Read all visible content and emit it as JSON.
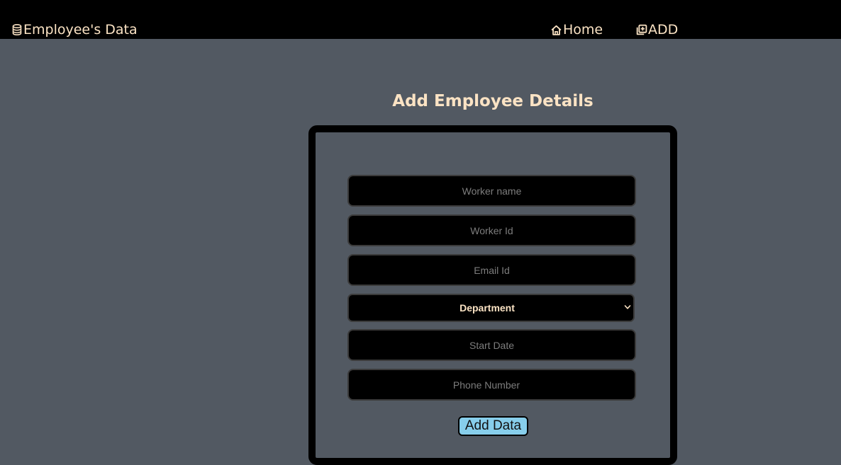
{
  "navbar": {
    "brand_icon": "database-icon",
    "brand_label": "Employee's Data",
    "links": [
      {
        "icon": "house-icon",
        "label": "Home"
      },
      {
        "icon": "add-copy-icon",
        "label": "ADD"
      }
    ]
  },
  "form": {
    "title": "Add Employee Details",
    "fields": {
      "worker_name": {
        "placeholder": "Worker name",
        "value": ""
      },
      "worker_id": {
        "placeholder": "Worker Id",
        "value": ""
      },
      "email_id": {
        "placeholder": "Email Id",
        "value": ""
      },
      "department": {
        "selected": "Department"
      },
      "start_date": {
        "placeholder": "Start Date",
        "value": ""
      },
      "phone_number": {
        "placeholder": "Phone Number",
        "value": ""
      }
    },
    "submit_label": "Add Data"
  },
  "colors": {
    "navbar_bg": "#000000",
    "page_bg": "#525962",
    "text_accent": "#fbe3c4",
    "button_bg": "#87ceeb",
    "field_bg": "#000000"
  }
}
